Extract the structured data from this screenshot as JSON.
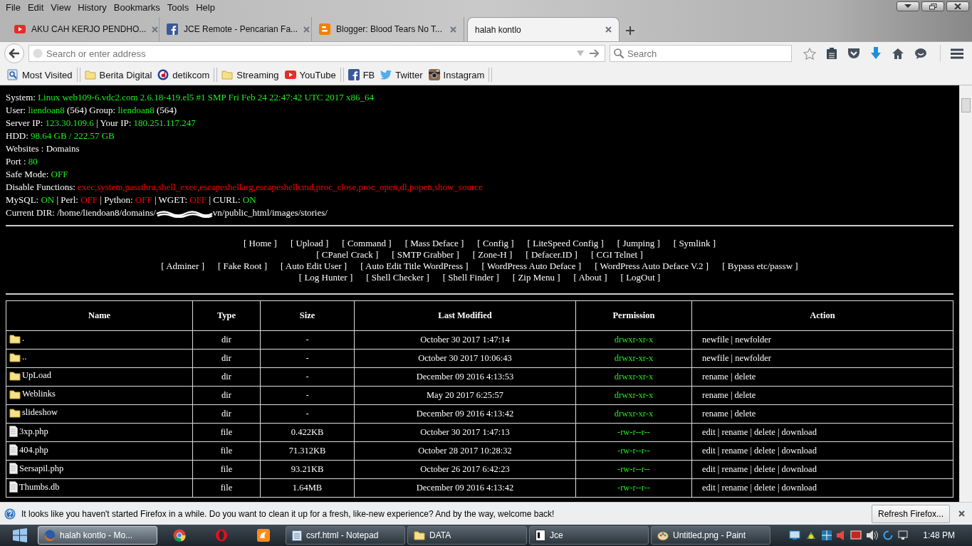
{
  "menubar": [
    "File",
    "Edit",
    "View",
    "History",
    "Bookmarks",
    "Tools",
    "Help"
  ],
  "tabs": [
    {
      "label": "AKU CAH KERJO PENDHO...",
      "selected": false
    },
    {
      "label": "JCE Remote - Pencarian Fa...",
      "selected": false
    },
    {
      "label": "Blogger: Blood Tears No T...",
      "selected": false
    },
    {
      "label": "halah kontlo",
      "selected": true
    }
  ],
  "address": {
    "placeholder": "Search or enter address"
  },
  "search": {
    "placeholder": "Search"
  },
  "bookmark_groups": [
    {
      "items": [
        "Most Visited"
      ]
    },
    {
      "items": [
        "Berita Digital",
        "detikcom"
      ]
    },
    {
      "items": [
        "Streaming",
        "YouTube"
      ]
    },
    {
      "items": [
        "FB",
        "Twitter",
        "Instagram"
      ]
    }
  ],
  "info_lines": [
    [
      {
        "text": "System: ",
        "color": "#ffffff"
      },
      {
        "text": "Linux web109-6.vdc2.com 2.6.18-419.el5 #1 SMP Fri Feb 24 22:47:42 UTC 2017 x86_64",
        "color": "#1df01d"
      }
    ],
    [
      {
        "text": "User: ",
        "color": "#ffffff"
      },
      {
        "text": "liendoan8",
        "color": "#1df01d"
      },
      {
        "text": " (564) Group: ",
        "color": "#ffffff"
      },
      {
        "text": "liendoan8",
        "color": "#1df01d"
      },
      {
        "text": " (564)",
        "color": "#ffffff"
      }
    ],
    [
      {
        "text": "Server IP: ",
        "color": "#ffffff"
      },
      {
        "text": "123.30.109.6",
        "color": "#1df01d"
      },
      {
        "text": " | Your IP: ",
        "color": "#ffffff"
      },
      {
        "text": "180.251.117.247",
        "color": "#1df01d"
      }
    ],
    [
      {
        "text": "HDD: ",
        "color": "#ffffff"
      },
      {
        "text": "98.64 GB / 222.57 GB",
        "color": "#1df01d"
      }
    ],
    [
      {
        "text": "Websites : Domains",
        "color": "#ffffff"
      }
    ],
    [
      {
        "text": "Port : ",
        "color": "#ffffff"
      },
      {
        "text": "80",
        "color": "#1df01d"
      }
    ],
    [
      {
        "text": "Safe Mode: ",
        "color": "#ffffff"
      },
      {
        "text": "OFF",
        "color": "#1df01d"
      }
    ],
    [
      {
        "text": "Disable Functions: ",
        "color": "#ffffff"
      },
      {
        "text": "exec,system,passthru,shell_exec,escapeshellarg,escapeshellcmd,proc_close,proc_open,dl,popen,show_source",
        "color": "#ff0000"
      }
    ],
    [
      {
        "text": "MySQL: ",
        "color": "#ffffff"
      },
      {
        "text": "ON",
        "color": "#1df01d"
      },
      {
        "text": " | Perl: ",
        "color": "#ffffff"
      },
      {
        "text": "OFF",
        "color": "#ff0000"
      },
      {
        "text": " | Python: ",
        "color": "#ffffff"
      },
      {
        "text": "OFF",
        "color": "#ff0000"
      },
      {
        "text": " | WGET: ",
        "color": "#ffffff"
      },
      {
        "text": "OFF",
        "color": "#ff0000"
      },
      {
        "text": " | CURL: ",
        "color": "#ffffff"
      },
      {
        "text": "ON",
        "color": "#1df01d"
      }
    ],
    [
      {
        "text": "Current DIR: /home/liendoan8/domains/",
        "color": "#ffffff"
      },
      {
        "redacted": true
      },
      {
        "text": "vn/public_html/images/stories/",
        "color": "#ffffff"
      }
    ]
  ],
  "nav_rows": [
    [
      "[ Home ]",
      "[ Upload ]",
      "[ Command ]",
      "[ Mass Deface ]",
      "[ Config ]",
      "[ LiteSpeed Config ]",
      "[ Jumping ]",
      "[ Symlink ]"
    ],
    [
      "[ CPanel Crack ]",
      "[ SMTP Grabber ]",
      "[ Zone-H ]",
      "[ Defacer.ID ]",
      "[ CGI Telnet ]"
    ],
    [
      "[ Adminer ]",
      "[ Fake Root ]",
      "[ Auto Edit User ]",
      "[ Auto Edit Title WordPress ]",
      "[ WordPress Auto Deface ]",
      "[ WordPress Auto Deface V.2 ]",
      "[ Bypass etc/passw ]"
    ],
    [
      "[ Log Hunter ]",
      "[ Shell Checker ]",
      "[ Shell Finder ]",
      "[ Zip Menu ]",
      "[ About ]",
      "[ LogOut ]"
    ]
  ],
  "table": {
    "columns": [
      "Name",
      "Type",
      "Size",
      "Last Modified",
      "Permission",
      "Action"
    ],
    "rows": [
      {
        "is_folder": true,
        "name": ".",
        "type": "dir",
        "size": "-",
        "modified": "October 30 2017 1:47:14",
        "permission": "drwxr-xr-x",
        "action": "newfile | newfolder"
      },
      {
        "is_folder": true,
        "name": "..",
        "type": "dir",
        "size": "-",
        "modified": "October 30 2017 10:06:43",
        "permission": "drwxr-xr-x",
        "action": "newfile | newfolder"
      },
      {
        "is_folder": true,
        "name": "UpLoad",
        "type": "dir",
        "size": "-",
        "modified": "December 09 2016 4:13:53",
        "permission": "drwxr-xr-x",
        "action": "rename | delete"
      },
      {
        "is_folder": true,
        "name": "Weblinks",
        "type": "dir",
        "size": "-",
        "modified": "May 20 2017 6:25:57",
        "permission": "drwxr-xr-x",
        "action": "rename | delete"
      },
      {
        "is_folder": true,
        "name": "slideshow",
        "type": "dir",
        "size": "-",
        "modified": "December 09 2016 4:13:42",
        "permission": "drwxr-xr-x",
        "action": "rename | delete"
      },
      {
        "is_folder": false,
        "name": "3xp.php",
        "type": "file",
        "size": "0.422KB",
        "modified": "October 30 2017 1:47:13",
        "permission": "-rw-r--r--",
        "action": "edit | rename | delete | download"
      },
      {
        "is_folder": false,
        "name": "404.php",
        "type": "file",
        "size": "71.312KB",
        "modified": "October 28 2017 10:28:32",
        "permission": "-rw-r--r--",
        "action": "edit | rename | delete | download"
      },
      {
        "is_folder": false,
        "name": "Sersapil.php",
        "type": "file",
        "size": "93.21KB",
        "modified": "October 26 2017 6:42:23",
        "permission": "-rw-r--r--",
        "action": "edit | rename | delete | download"
      },
      {
        "is_folder": false,
        "name": "Thumbs.db",
        "type": "file",
        "size": "1.64MB",
        "modified": "December 09 2016 4:13:42",
        "permission": "-rw-r--r--",
        "action": "edit | rename | delete | download"
      }
    ]
  },
  "notification": {
    "text": "It looks like you haven't started Firefox in a while. Do you want to clean it up for a fresh, like-new experience? And by the way, welcome back!",
    "button": "Refresh Firefox..."
  },
  "taskbar": {
    "items": [
      {
        "pinned": false,
        "label": "halah kontlo - Mo...",
        "selected": true
      },
      {
        "pinned": true
      },
      {
        "pinned": true
      },
      {
        "pinned": true
      },
      {
        "pinned": false,
        "label": "csrf.html - Notepad",
        "selected": false
      },
      {
        "pinned": false,
        "label": "DATA",
        "selected": false
      },
      {
        "pinned": false,
        "label": "Jce",
        "selected": false
      },
      {
        "pinned": false,
        "label": "Untitled.png - Paint",
        "selected": false
      }
    ],
    "time": "1:48 PM"
  }
}
